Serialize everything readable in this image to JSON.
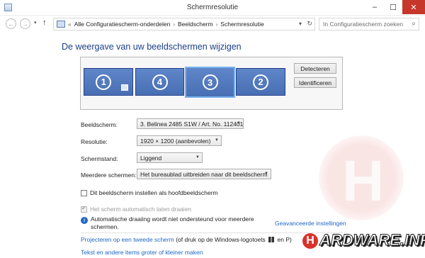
{
  "window": {
    "title": "Schermresolutie",
    "min": "–",
    "max": "☐",
    "close": "✕"
  },
  "nav": {
    "back": "←",
    "forward": "→",
    "recent": "▾",
    "up": "↑"
  },
  "breadcrumb": {
    "items": [
      "Alle Configuratiescherm-onderdelen",
      "Beeldscherm",
      "Schermresolutie"
    ],
    "separator": "›",
    "leading": "«",
    "dropdown": "▾",
    "refresh": "↻"
  },
  "search": {
    "placeholder": "In Configuratiescherm zoeken",
    "icon": "⌕"
  },
  "heading": "De weergave van uw beeldschermen wijzigen",
  "monitors": [
    {
      "number": "1",
      "selected": false
    },
    {
      "number": "4",
      "selected": false
    },
    {
      "number": "3",
      "selected": true
    },
    {
      "number": "2",
      "selected": false
    }
  ],
  "buttons": {
    "detect": "Detecteren",
    "identify": "Identificeren"
  },
  "form": {
    "display_label": "Beeldscherm:",
    "display_value": "3. Belinea 2485 S1W / Art. No. 112401",
    "resolution_label": "Resolutie:",
    "resolution_value": "1920 × 1200 (aanbevolen)",
    "orientation_label": "Schermstand:",
    "orientation_value": "Liggend",
    "multi_label": "Meerdere schermen:",
    "multi_value": "Het bureaublad uitbreiden naar dit beeldscherm",
    "arrow": "▼"
  },
  "checkboxes": {
    "main_display": "Dit beeldscherm instellen als hoofdbeeldscherm",
    "auto_rotate": "Het scherm automatisch laten draaien",
    "check": "✔"
  },
  "info": {
    "icon": "i",
    "text": "Automatische draaiing wordt niet ondersteund voor meerdere schermen."
  },
  "advanced_link": "Geavanceerde instellingen",
  "links": {
    "project_link": "Projecteren op een tweede scherm",
    "project_suffix_1": " (of druk op de Windows-logotoets ",
    "project_suffix_2": " en P)",
    "text_size_link": "Tekst en andere items groter of kleiner maken"
  },
  "watermark": {
    "h": "H",
    "text": "ARDWARE.INFO"
  }
}
